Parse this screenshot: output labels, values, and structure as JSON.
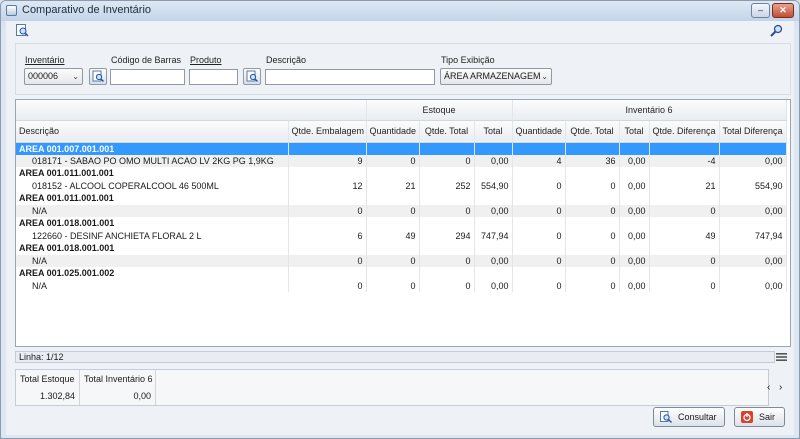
{
  "window": {
    "title": "Comparativo de Inventário",
    "minimize_label": "–",
    "close_label": "✕"
  },
  "toolbar": {
    "filter_icon": "magnifier-document-icon",
    "search_icon": "magnifier-icon"
  },
  "form": {
    "inventario": {
      "label": "Inventário",
      "value": "000006"
    },
    "codigo_barras": {
      "label": "Código de Barras",
      "value": ""
    },
    "produto": {
      "label": "Produto",
      "value": ""
    },
    "descricao": {
      "label": "Descrição",
      "value": ""
    },
    "tipo_exibicao": {
      "label": "Tipo Exibição",
      "value": "ÁREA ARMAZENAGEM"
    }
  },
  "grid": {
    "group_headers": {
      "estoque": "Estoque",
      "inventario": "Inventário 6"
    },
    "columns": [
      "Descrição",
      "Qtde. Embalagem",
      "Quantidade",
      "Qtde. Total",
      "Total",
      "Quantidade",
      "Qtde. Total",
      "Total",
      "Qtde. Diferença",
      "Total Diferença"
    ],
    "rows": [
      {
        "type": "group",
        "selected": true,
        "desc": "AREA 001.007.001.001"
      },
      {
        "type": "item",
        "desc": "018171 - SABAO PO OMO MULTI ACAO LV 2KG PG 1,9KG",
        "vals": [
          "9",
          "0",
          "0",
          "0,00",
          "4",
          "36",
          "0,00",
          "-4",
          "0,00"
        ]
      },
      {
        "type": "group",
        "desc": "AREA 001.011.001.001"
      },
      {
        "type": "item",
        "desc": "018152 - ALCOOL COPERALCOOL 46 500ML",
        "vals": [
          "12",
          "21",
          "252",
          "554,90",
          "0",
          "0",
          "0,00",
          "21",
          "554,90"
        ]
      },
      {
        "type": "group",
        "desc": "AREA 001.011.001.001"
      },
      {
        "type": "item",
        "desc": "N/A",
        "vals": [
          "0",
          "0",
          "0",
          "0,00",
          "0",
          "0",
          "0,00",
          "0",
          "0,00"
        ]
      },
      {
        "type": "group",
        "desc": "AREA 001.018.001.001"
      },
      {
        "type": "item",
        "desc": "122660 - DESINF ANCHIETA FLORAL 2 L",
        "vals": [
          "6",
          "49",
          "294",
          "747,94",
          "0",
          "0",
          "0,00",
          "49",
          "747,94"
        ]
      },
      {
        "type": "group",
        "desc": "AREA 001.018.001.001"
      },
      {
        "type": "item",
        "desc": "N/A",
        "vals": [
          "0",
          "0",
          "0",
          "0,00",
          "0",
          "0",
          "0,00",
          "0",
          "0,00"
        ]
      },
      {
        "type": "group",
        "desc": "AREA 001.025.001.002"
      },
      {
        "type": "item",
        "desc": "N/A",
        "vals": [
          "0",
          "0",
          "0",
          "0,00",
          "0",
          "0",
          "0,00",
          "0",
          "0,00"
        ]
      }
    ]
  },
  "status": {
    "linha": "Linha: 1/12"
  },
  "totals": [
    {
      "label": "Total Estoque",
      "value": "1.302,84"
    },
    {
      "label": "Total Inventário 6",
      "value": "0,00"
    }
  ],
  "nav": {
    "prev": "‹",
    "next": "›"
  },
  "buttons": {
    "consultar": "Consultar",
    "sair": "Sair"
  },
  "colors": {
    "selection": "#3399ff",
    "sair_icon": "#d9412b"
  }
}
